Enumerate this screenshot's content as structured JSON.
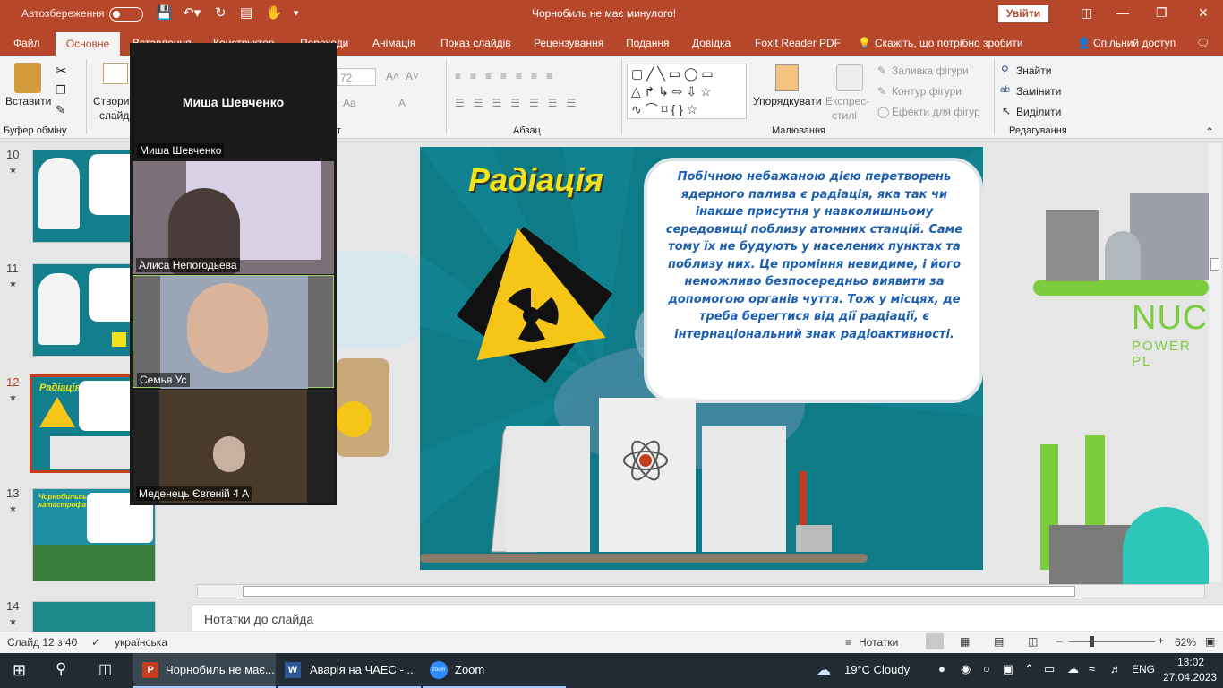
{
  "titlebar": {
    "autosave_label": "Автозбереження",
    "doc_title": "Чорнобиль не має минулого!",
    "signin_label": "Увійти"
  },
  "tabs": [
    "Файл",
    "Основне",
    "Вставлення",
    "Конструктор",
    "Переходи",
    "Анімація",
    "Показ слайдів",
    "Рецензування",
    "Подання",
    "Довідка",
    "Foxit Reader PDF"
  ],
  "tell_me": "Скажіть, що потрібно зробити",
  "share": "Спільний доступ",
  "ribbon": {
    "paste": "Вставити",
    "clipboard_group": "Буфер обміну",
    "new_slide_1": "Створити",
    "new_slide_2": "слайд",
    "font_size": "72",
    "paragraph_group": "Абзац",
    "arrange": "Упорядкувати",
    "quick_styles_1": "Експрес-",
    "quick_styles_2": "стилі",
    "shape_fill": "Заливка фігури",
    "shape_outline": "Контур фігури",
    "shape_effects": "Ефекти для фігур",
    "drawing_group": "Малювання",
    "find": "Знайти",
    "replace": "Замінити",
    "select": "Виділити",
    "editing_group": "Редагування",
    "font_group_tail": "т"
  },
  "thumbs": [
    {
      "num": "10",
      "title": ""
    },
    {
      "num": "11",
      "title": ""
    },
    {
      "num": "12",
      "title": "Радіація"
    },
    {
      "num": "13",
      "title": "Чорнобильська катастрофа"
    },
    {
      "num": "14",
      "title": ""
    }
  ],
  "slide": {
    "title": "Радіація",
    "body": "Побічною небажаною дією перетворень ядерного палива є радіація, яка так чи інакше присутня у навколишньому середовищі поблизу атомних станцій. Саме тому їх не будують у населених пунктах та поблизу них. Це проміння невидиме, і його неможливо безпосередньо виявити за допомогою органів чуття. Тож у місцях, де треба берегтися від дії радіації, є інтернаціональний знак радіоактивності.",
    "next_slide_text_1": "NUCLE",
    "next_slide_text_2": "POWER PL"
  },
  "notes_placeholder": "Нотатки до слайда",
  "status": {
    "slide_of": "Слайд 12 з 40",
    "language": "українська",
    "notes": "Нотатки",
    "zoom": "62%"
  },
  "zoom_overlay": {
    "host_name": "Миша Шевченко",
    "host_label": "Миша Шевченко",
    "participants": [
      "Алиса Непогодьева",
      "Семья Ус",
      "Меденець Євгеній 4 А"
    ]
  },
  "taskbar": {
    "app1": "Чорнобиль не має...",
    "app2": "Аварія на ЧАЕС - ...",
    "app3": "Zoom",
    "weather": "19°C  Cloudy",
    "lang": "ENG",
    "time": "13:02",
    "date": "27.04.2023"
  },
  "colors": {
    "accent": "#b7472a",
    "slide_bg": "#0f7b87",
    "title_yellow": "#f5e31a",
    "body_text": "#1c5fb0"
  }
}
